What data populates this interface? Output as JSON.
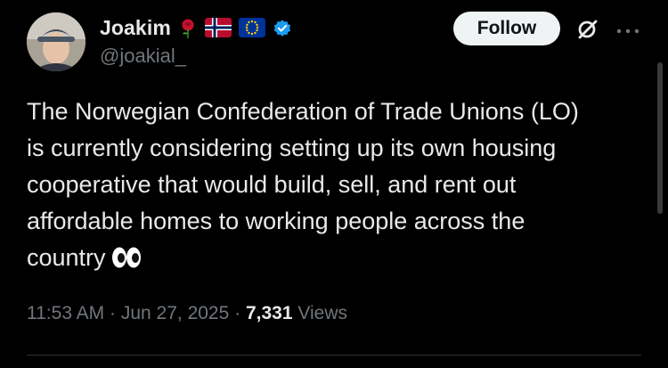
{
  "author": {
    "display_name": "Joakim",
    "handle": "@joakial_",
    "emojis": [
      "rose",
      "norway-flag",
      "eu-flag"
    ],
    "verified": true
  },
  "actions": {
    "follow_label": "Follow"
  },
  "tweet": {
    "text": "The Norwegian Confederation of Trade Unions (LO)\nis currently considering setting up its own housing\ncooperative that would build, sell, and rent out\naffordable homes to working people across the\ncountry",
    "trailing_emoji": "eyes"
  },
  "meta": {
    "time": "11:53 AM",
    "sep1": " · ",
    "date": "Jun 27, 2025",
    "sep2": " · ",
    "views_count": "7,331",
    "views_label": " Views"
  },
  "colors": {
    "background": "#000000",
    "text": "#e7e9ea",
    "muted": "#71767b",
    "verified_blue": "#1d9bf0",
    "follow_bg": "#eff3f4"
  }
}
